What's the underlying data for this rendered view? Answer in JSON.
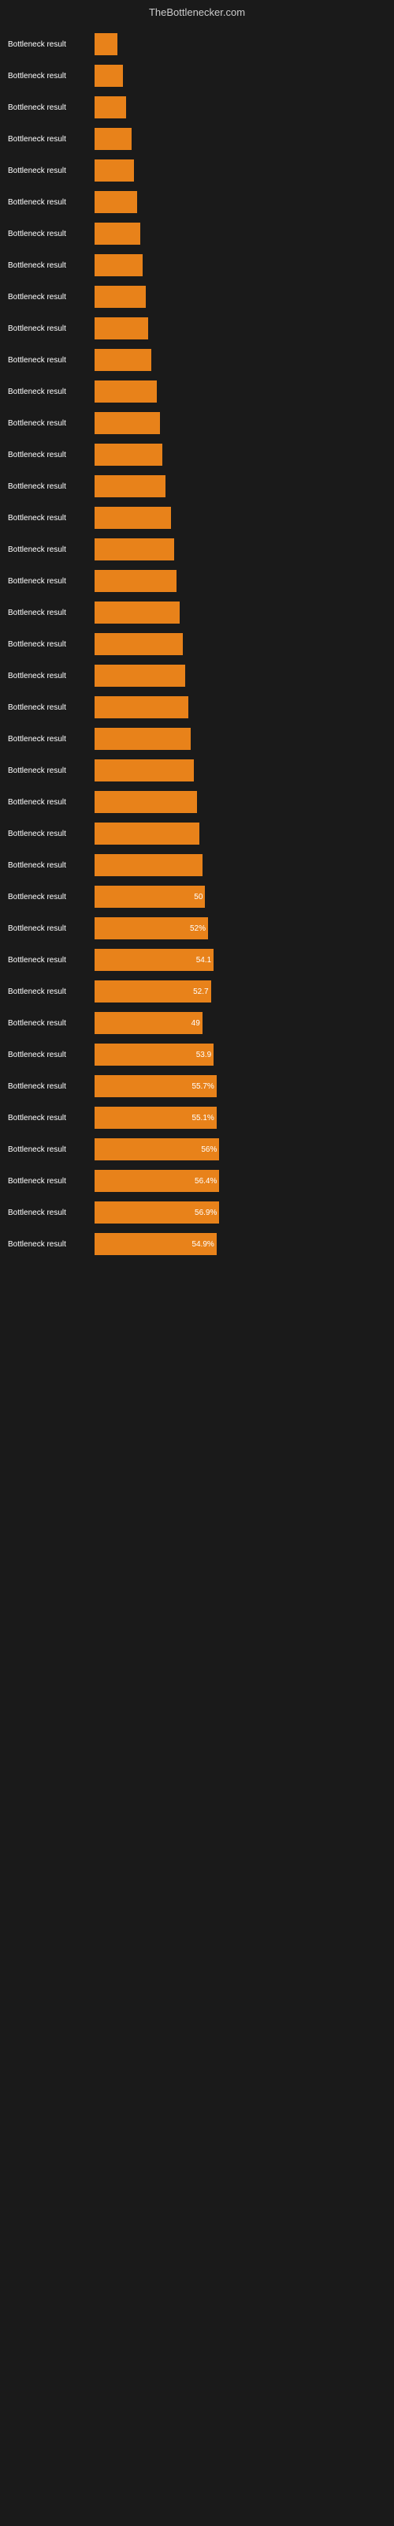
{
  "header": {
    "title": "TheBottlenecker.com"
  },
  "bars": [
    {
      "label": "Bottleneck result",
      "value": null,
      "width_pct": 8
    },
    {
      "label": "Bottleneck result",
      "value": null,
      "width_pct": 10
    },
    {
      "label": "Bottleneck result",
      "value": null,
      "width_pct": 11
    },
    {
      "label": "Bottleneck result",
      "value": null,
      "width_pct": 13
    },
    {
      "label": "Bottleneck result",
      "value": null,
      "width_pct": 14
    },
    {
      "label": "Bottleneck result",
      "value": null,
      "width_pct": 15
    },
    {
      "label": "Bottleneck result",
      "value": null,
      "width_pct": 16
    },
    {
      "label": "Bottleneck result",
      "value": null,
      "width_pct": 17
    },
    {
      "label": "Bottleneck result",
      "value": null,
      "width_pct": 18
    },
    {
      "label": "Bottleneck result",
      "value": null,
      "width_pct": 19
    },
    {
      "label": "Bottleneck result",
      "value": null,
      "width_pct": 20
    },
    {
      "label": "Bottleneck result",
      "value": null,
      "width_pct": 22
    },
    {
      "label": "Bottleneck result",
      "value": null,
      "width_pct": 23
    },
    {
      "label": "Bottleneck result",
      "value": null,
      "width_pct": 24
    },
    {
      "label": "Bottleneck result",
      "value": null,
      "width_pct": 25
    },
    {
      "label": "Bottleneck result",
      "value": null,
      "width_pct": 27
    },
    {
      "label": "Bottleneck result",
      "value": null,
      "width_pct": 28
    },
    {
      "label": "Bottleneck result",
      "value": null,
      "width_pct": 29
    },
    {
      "label": "Bottleneck result",
      "value": null,
      "width_pct": 30
    },
    {
      "label": "Bottleneck result",
      "value": null,
      "width_pct": 31
    },
    {
      "label": "Bottleneck result",
      "value": null,
      "width_pct": 32
    },
    {
      "label": "Bottleneck result",
      "value": null,
      "width_pct": 33
    },
    {
      "label": "Bottleneck result",
      "value": null,
      "width_pct": 34
    },
    {
      "label": "Bottleneck result",
      "value": null,
      "width_pct": 35
    },
    {
      "label": "Bottleneck result",
      "value": null,
      "width_pct": 36
    },
    {
      "label": "Bottleneck result",
      "value": null,
      "width_pct": 37
    },
    {
      "label": "Bottleneck result",
      "value": null,
      "width_pct": 38
    },
    {
      "label": "Bottleneck result",
      "value": "50",
      "width_pct": 39
    },
    {
      "label": "Bottleneck result",
      "value": "52%",
      "width_pct": 40
    },
    {
      "label": "Bottleneck result",
      "value": "54.1",
      "width_pct": 42
    },
    {
      "label": "Bottleneck result",
      "value": "52.7",
      "width_pct": 41
    },
    {
      "label": "Bottleneck result",
      "value": "49",
      "width_pct": 38
    },
    {
      "label": "Bottleneck result",
      "value": "53.9",
      "width_pct": 42
    },
    {
      "label": "Bottleneck result",
      "value": "55.7%",
      "width_pct": 43
    },
    {
      "label": "Bottleneck result",
      "value": "55.1%",
      "width_pct": 43
    },
    {
      "label": "Bottleneck result",
      "value": "56%",
      "width_pct": 44
    },
    {
      "label": "Bottleneck result",
      "value": "56.4%",
      "width_pct": 44
    },
    {
      "label": "Bottleneck result",
      "value": "56.9%",
      "width_pct": 44
    },
    {
      "label": "Bottleneck result",
      "value": "54.9%",
      "width_pct": 43
    }
  ]
}
